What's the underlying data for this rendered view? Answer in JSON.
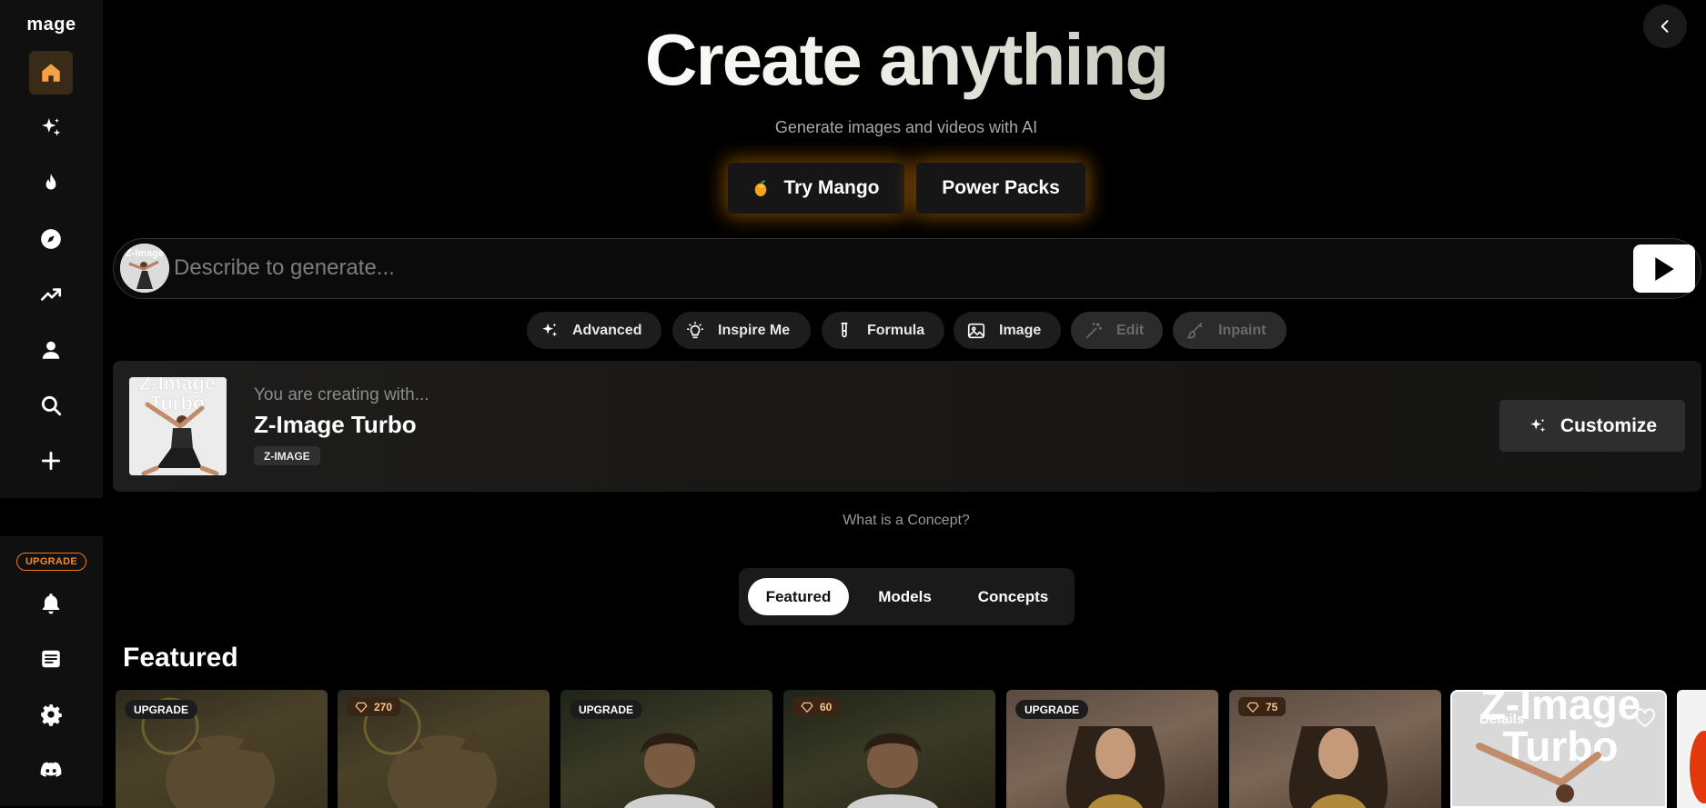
{
  "app": {
    "logo": "mage"
  },
  "sidebar": {
    "top_items": [
      {
        "icon": "home-icon"
      },
      {
        "icon": "sparkles-icon"
      },
      {
        "icon": "flame-icon"
      },
      {
        "icon": "compass-icon"
      },
      {
        "icon": "trending-up-icon"
      },
      {
        "icon": "user-icon"
      },
      {
        "icon": "search-icon"
      },
      {
        "icon": "plus-icon"
      }
    ],
    "upgrade_label": "UPGRADE",
    "bottom_items": [
      {
        "icon": "bell-icon"
      },
      {
        "icon": "document-icon"
      },
      {
        "icon": "settings-icon"
      },
      {
        "icon": "discord-icon"
      }
    ]
  },
  "hero": {
    "title": "Create anything",
    "subtitle": "Generate images and videos with AI",
    "cta_primary": "Try Mango",
    "cta_secondary": "Power Packs"
  },
  "prompt": {
    "placeholder": "Describe to generate...",
    "avatar_text": "Z-Image Turbo"
  },
  "tools": {
    "advanced": "Advanced",
    "inspire": "Inspire Me",
    "formula": "Formula",
    "image": "Image",
    "edit": "Edit",
    "inpaint": "Inpaint"
  },
  "concept": {
    "kicker": "You are creating with...",
    "name": "Z-Image Turbo",
    "tag": "Z-IMAGE",
    "thumb_text": "Z-Image Turbo",
    "customize_label": "Customize",
    "help_link": "What is a Concept?"
  },
  "tabs": {
    "featured": "Featured",
    "models": "Models",
    "concepts": "Concepts"
  },
  "section": {
    "title": "Featured"
  },
  "tiles": {
    "t1": {
      "badge": "UPGRADE"
    },
    "t2": {
      "price": "270"
    },
    "t3": {
      "badge": "UPGRADE"
    },
    "t4": {
      "price": "60"
    },
    "t5": {
      "badge": "UPGRADE"
    },
    "t6": {
      "price": "75"
    },
    "t7": {
      "details": "Details",
      "overlay": "Z-Image Turbo"
    }
  },
  "colors": {
    "accent": "#f07a1a",
    "active_nav_bg": "#3a2a18",
    "glow": "#ff9600"
  }
}
